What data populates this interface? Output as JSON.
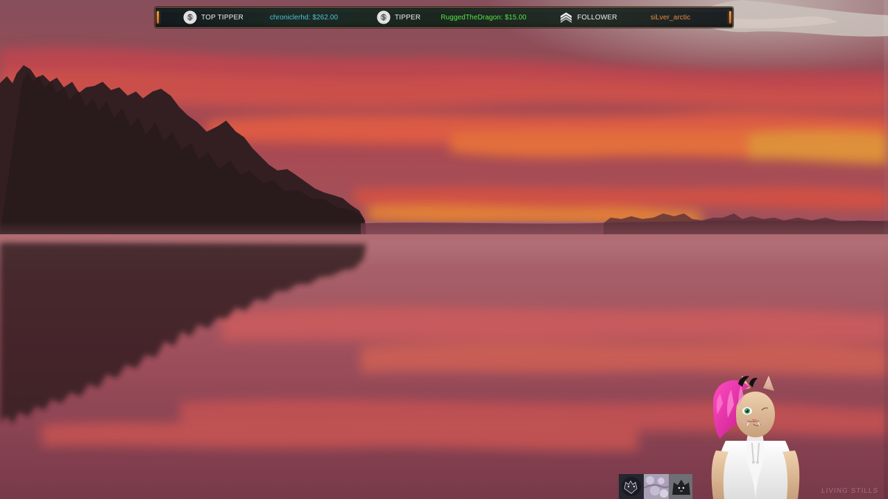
{
  "ticker": {
    "top_tipper": {
      "icon": "coin-icon",
      "label": "TOP TIPPER",
      "value": "chroniclerhd: $262.00",
      "color": "#51c3dc"
    },
    "tipper": {
      "icon": "coin-icon",
      "label": "TIPPER",
      "value": "RuggedTheDragon: $15.00",
      "color": "#58e641"
    },
    "follower": {
      "icon": "chevron-rank-icon",
      "label": "FOLLOWER",
      "value": "siLver_arctic",
      "color": "#ef8c3e"
    },
    "border_color": "#7c5a3d"
  },
  "overlay": {
    "watermark": "LIVING STILLS"
  },
  "scene": {
    "sky_colors": [
      "#8f5561",
      "#b74e55",
      "#e96148",
      "#f6a33a"
    ],
    "water_colors": [
      "#7a3444",
      "#a34b58",
      "#d35a5b"
    ]
  },
  "avatar": {
    "hair_color": "#ef2fa3",
    "fur_color": "#d9b48f",
    "shirt_color": "#f1f1f1"
  }
}
